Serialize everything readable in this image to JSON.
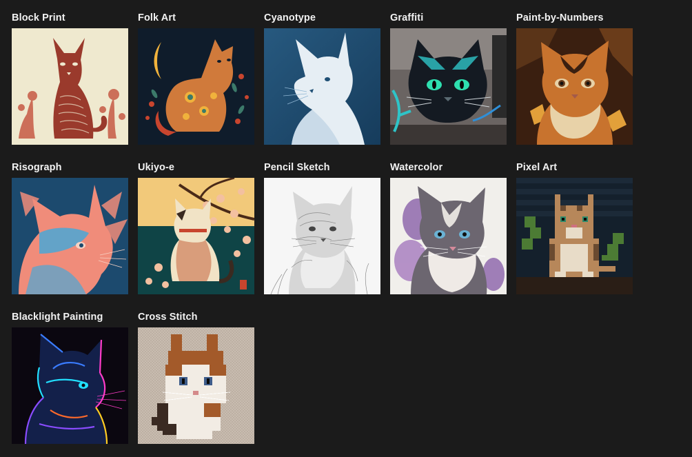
{
  "gallery": {
    "items": [
      {
        "title": "Block Print",
        "icon": "cat-block-print-image",
        "colors": {
          "bg": "#efe9cf",
          "fg": "#9a3a2c",
          "accent": "#c65a45"
        }
      },
      {
        "title": "Folk Art",
        "icon": "cat-folk-art-image",
        "colors": {
          "bg": "#0f1c2b",
          "fg": "#d07a3b",
          "accent": "#f0b23c"
        }
      },
      {
        "title": "Cyanotype",
        "icon": "cat-cyanotype-image",
        "colors": {
          "bg": "#1f4f74",
          "fg": "#e6eef4",
          "accent": "#8fb6d3"
        }
      },
      {
        "title": "Graffiti",
        "icon": "cat-graffiti-image",
        "colors": {
          "bg": "#6a6462",
          "fg": "#141a22",
          "accent": "#2ec4c8"
        }
      },
      {
        "title": "Paint-by-Numbers",
        "icon": "cat-paint-by-numbers-image",
        "colors": {
          "bg": "#3a1f10",
          "fg": "#c8732e",
          "accent": "#e8d2a8"
        }
      },
      {
        "title": "Risograph",
        "icon": "cat-risograph-image",
        "colors": {
          "bg": "#1c4a6e",
          "fg": "#f08c7a",
          "accent": "#4aa7d6"
        }
      },
      {
        "title": "Ukiyo-e",
        "icon": "cat-ukiyo-e-image",
        "colors": {
          "bg": "#0f4446",
          "fg": "#f1e3c6",
          "accent": "#f3c0a0"
        }
      },
      {
        "title": "Pencil Sketch",
        "icon": "cat-pencil-sketch-image",
        "colors": {
          "bg": "#f6f6f6",
          "fg": "#8a8a8a",
          "accent": "#444444"
        }
      },
      {
        "title": "Watercolor",
        "icon": "cat-watercolor-image",
        "colors": {
          "bg": "#f1efeb",
          "fg": "#6c6670",
          "accent": "#7c4ea1"
        }
      },
      {
        "title": "Pixel Art",
        "icon": "cat-pixel-art-image",
        "colors": {
          "bg": "#14202c",
          "fg": "#b7875a",
          "accent": "#4c7b34"
        }
      },
      {
        "title": "Blacklight Painting",
        "icon": "cat-blacklight-painting-image",
        "colors": {
          "bg": "#0b0710",
          "fg": "#3a7cff",
          "accent": "#ff3cc8"
        }
      },
      {
        "title": "Cross Stitch",
        "icon": "cat-cross-stitch-image",
        "colors": {
          "bg": "#c8bcb0",
          "fg": "#a35a2a",
          "accent": "#f2ece4"
        }
      }
    ]
  }
}
